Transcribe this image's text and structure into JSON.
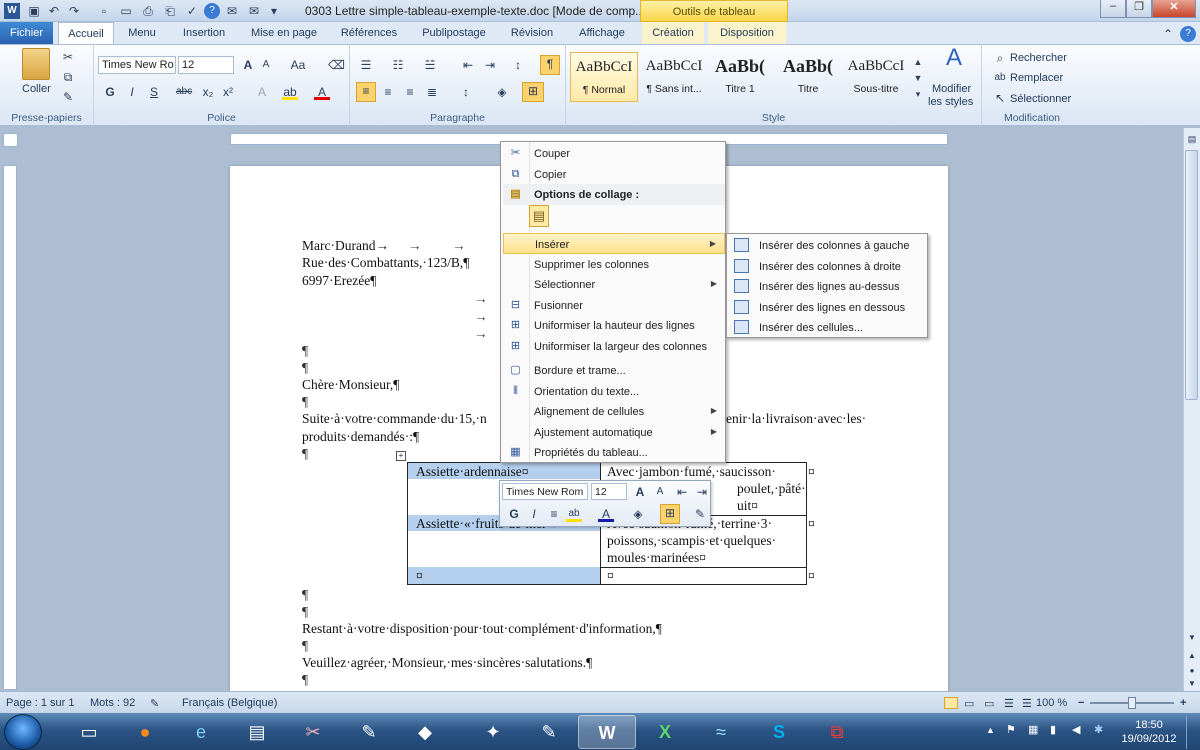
{
  "window": {
    "title": "0303 Lettre simple-tableau-exemple-texte.doc [Mode de comp...",
    "contextual_tab_header": "Outils de tableau"
  },
  "tabs": [
    "Fichier",
    "Accueil",
    "Menu",
    "Insertion",
    "Mise en page",
    "Références",
    "Publipostage",
    "Révision",
    "Affichage",
    "Création",
    "Disposition"
  ],
  "ribbon": {
    "clipboard": {
      "paste_label": "Coller",
      "group": "Presse-papiers"
    },
    "font": {
      "name": "Times New Ro",
      "size": "12",
      "group": "Police"
    },
    "paragraph": {
      "group": "Paragraphe"
    },
    "styles": {
      "group": "Style",
      "items": [
        {
          "preview": "AaBbCcI",
          "name": "¶ Normal"
        },
        {
          "preview": "AaBbCcI",
          "name": "¶ Sans int..."
        },
        {
          "preview": "AaBb(",
          "name": "Titre 1"
        },
        {
          "preview": "AaBb(",
          "name": "Titre"
        },
        {
          "preview": "AaBbCcI",
          "name": "Sous-titre"
        }
      ],
      "modify_label_1": "Modifier",
      "modify_label_2": "les styles"
    },
    "editing": {
      "group": "Modification",
      "find": "Rechercher",
      "replace": "Remplacer",
      "select": "Sélectionner"
    }
  },
  "document": {
    "address": [
      "Marc·Durand→",
      "Rue·des·Combattants,·123/B,¶",
      "6997·Erezée¶"
    ],
    "pilcrow": "¶",
    "arrow": "→",
    "salutation": "Chère·Monsieur,¶",
    "body_line1_left": "Suite·à·votre·commande·du·15,·n",
    "body_line1_right": "enir·la·livraison·avec·les·",
    "body_line2": "produits·demandés·:¶",
    "closing1": "Restant·à·votre·disposition·pour·tout·complément·d'information,¶",
    "closing2": "Veuillez·agréer,·Monsieur,·mes·sincères·salutations.¶",
    "table": {
      "r1c1": "Assiette·ardennaise¤",
      "r1c2_l1": "Avec·jambon·fumé,·saucisson·",
      "r1c2_l2": "poulet,·pâté·",
      "r1c2_l3": "uit¤",
      "r2c1": "Assiette·«·fruits·de·mer·»¤",
      "r2c2_l1": "Avec·saumon·fumé,·terrine·3·",
      "r2c2_l2": "poissons,·scampis·et·quelques·",
      "r2c2_l3": "moules·marinées¤",
      "cell_mark": "¤"
    }
  },
  "context_menu": {
    "items": [
      {
        "label": "Couper",
        "icon": "scissors-icon"
      },
      {
        "label": "Copier",
        "icon": "copy-icon"
      },
      {
        "label": "Options de collage :",
        "icon": "paste-icon"
      },
      {
        "label": "Insérer",
        "icon": "insert-icon"
      },
      {
        "label": "Supprimer les colonnes"
      },
      {
        "label": "Sélectionner"
      },
      {
        "label": "Fusionner",
        "icon": "merge-icon"
      },
      {
        "label": "Uniformiser la hauteur des lignes",
        "icon": "rows-icon"
      },
      {
        "label": "Uniformiser la largeur des colonnes",
        "icon": "cols-icon"
      },
      {
        "label": "Bordure et trame...",
        "icon": "border-icon"
      },
      {
        "label": "Orientation du texte...",
        "icon": "text-direction-icon"
      },
      {
        "label": "Alignement de cellules"
      },
      {
        "label": "Ajustement automatique"
      },
      {
        "label": "Propriétés du tableau...",
        "icon": "table-properties-icon"
      }
    ],
    "submenu": [
      "Insérer des colonnes à gauche",
      "Insérer des colonnes à droite",
      "Insérer des lignes au-dessus",
      "Insérer des lignes en dessous",
      "Insérer des cellules..."
    ]
  },
  "mini_toolbar": {
    "font": "Times New Rom",
    "size": "12"
  },
  "status": {
    "page": "Page : 1 sur 1",
    "words": "Mots : 92",
    "language": "Français (Belgique)",
    "zoom": "100 %"
  },
  "taskbar": {
    "time": "18:50",
    "date": "19/09/2012"
  }
}
